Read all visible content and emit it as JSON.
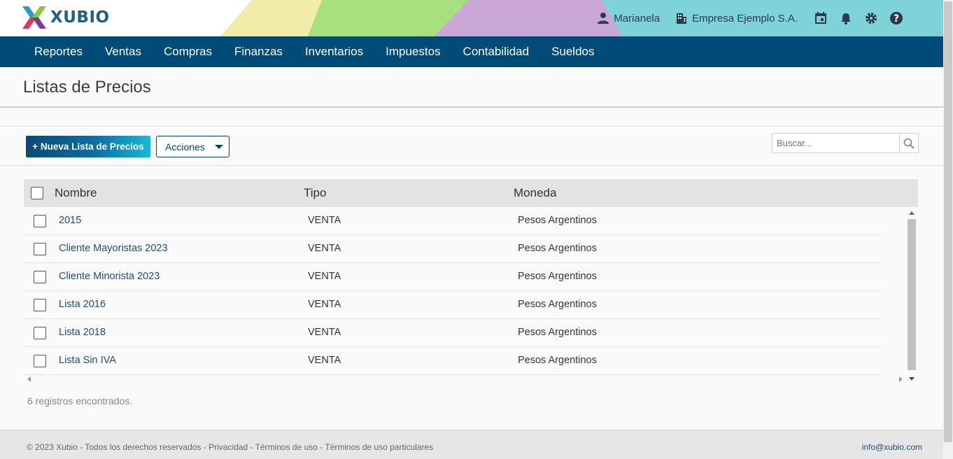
{
  "brand": {
    "name": "XUBIO"
  },
  "header": {
    "user": "Marianela",
    "company": "Empresa Ejemplo S.A.",
    "icons": [
      "user-icon",
      "building-icon",
      "calendar-icon",
      "bell-icon",
      "gear-icon",
      "help-icon"
    ]
  },
  "nav": {
    "items": [
      "Reportes",
      "Ventas",
      "Compras",
      "Finanzas",
      "Inventarios",
      "Impuestos",
      "Contabilidad",
      "Sueldos"
    ]
  },
  "page": {
    "title": "Listas de Precios"
  },
  "toolbar": {
    "new_label": "+ Nueva Lista de Precios",
    "actions_label": "Acciones",
    "search_placeholder": "Buscar..."
  },
  "table": {
    "columns": [
      "Nombre",
      "Tipo",
      "Moneda"
    ],
    "rows": [
      {
        "nombre": "2015",
        "tipo": "VENTA",
        "moneda": "Pesos Argentinos"
      },
      {
        "nombre": "Cliente Mayoristas 2023",
        "tipo": "VENTA",
        "moneda": "Pesos Argentinos"
      },
      {
        "nombre": "Cliente Minorista 2023",
        "tipo": "VENTA",
        "moneda": "Pesos Argentinos"
      },
      {
        "nombre": "Lista 2016",
        "tipo": "VENTA",
        "moneda": "Pesos Argentinos"
      },
      {
        "nombre": "Lista 2018",
        "tipo": "VENTA",
        "moneda": "Pesos Argentinos"
      },
      {
        "nombre": "Lista Sin IVA",
        "tipo": "VENTA",
        "moneda": "Pesos Argentinos"
      }
    ]
  },
  "records_text": "6 registros encontrados.",
  "footer": {
    "copyright": "© 2023 Xubio - Todos los derechos reservados - Privacidad - Términos de uso - Términos de uso particulares",
    "email": "info@xubio.com"
  },
  "colors": {
    "nav_bg": "#004b78",
    "accent": "#1b5f8c",
    "link": "#1e4f72"
  }
}
